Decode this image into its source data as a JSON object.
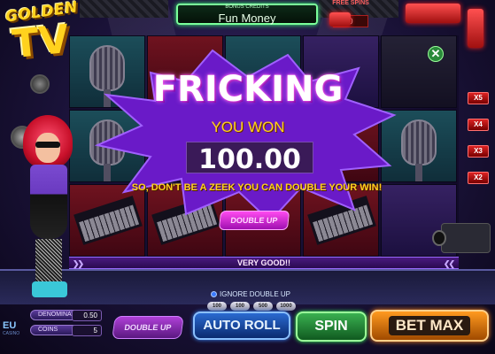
{
  "header": {
    "logo_text": "GOLDEN",
    "logo_tv": "TV",
    "credits_label": "BONUS CREDITS",
    "credits_value": "Fun Money",
    "freespins_label": "FREE SPINS",
    "freespins_value": "0"
  },
  "win_popup": {
    "title": "FRICKING",
    "subtitle": "YOU WON",
    "amount": "100.00",
    "hint": "SO, DON'T BE A ZEEK YOU CAN DOUBLE YOUR WIN!",
    "double_up_label": "DOUBLE UP"
  },
  "status_bar": {
    "text": "VERY GOOD!!"
  },
  "multipliers": [
    "X5",
    "X4",
    "X3",
    "X2"
  ],
  "controls": {
    "ignore_double_up": "IGNORE DOUBLE UP",
    "chips": [
      "100",
      "100",
      "500",
      "1000"
    ],
    "denomination_label": "DENOMINATION",
    "denomination_value": "0.50",
    "coins_label": "COINS",
    "coins_value": "5",
    "double_up_button": "DOUBLE UP",
    "auto_roll_button": "AUTO ROLL",
    "spin_button": "SPIN",
    "bet_max_button": "BET MAX",
    "provider_logo": "EU",
    "provider_sub": "CASINO"
  },
  "icons": {
    "close": "close-icon"
  },
  "colors": {
    "win_title_glow": "#ff2ae0",
    "win_text_gold": "#ffd21e",
    "burst_purple": "#6a1ac8",
    "spin_green": "#3ab050",
    "bet_max_orange": "#ff9a20",
    "auto_roll_blue": "#2a6ad0"
  }
}
